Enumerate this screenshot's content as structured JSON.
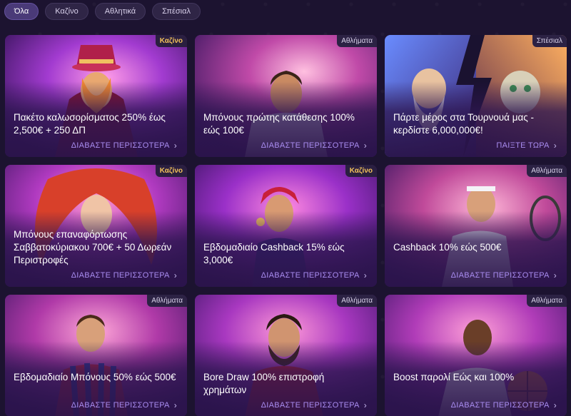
{
  "filters": [
    {
      "label": "Όλα",
      "active": true
    },
    {
      "label": "Καζίνο",
      "active": false
    },
    {
      "label": "Αθλητικά",
      "active": false
    },
    {
      "label": "Σπέσιαλ",
      "active": false
    }
  ],
  "cards": [
    {
      "badge": "Καζίνο",
      "title": "Πακέτο καλωσορίσματος 250% έως 2,500€ + 250 ΔΠ",
      "cta": "ΔΙΑΒΑΣΤΕ ΠΕΡΙΣΣΟΤΕΡΑ"
    },
    {
      "badge": "Αθλήματα",
      "title": "Μπόνους πρώτης κατάθεσης 100% εώς 100€",
      "cta": "ΔΙΑΒΑΣΤΕ ΠΕΡΙΣΣΟΤΕΡΑ"
    },
    {
      "badge": "Σπέσιαλ",
      "title": "Πάρτε μέρος στα Τουρνουά μας - κερδίστε 6,000,000€!",
      "cta": "ΠΑΙΞΤΕ ΤΩΡΑ"
    },
    {
      "badge": "Καζίνο",
      "title": "Μπόνους επαναφόρτωσης Σαββατοκύριακου 700€ + 50 Δωρεάν Περιστροφές",
      "cta": "ΔΙΑΒΑΣΤΕ ΠΕΡΙΣΣΟΤΕΡΑ"
    },
    {
      "badge": "Καζίνο",
      "title": "Εβδομαδιαίο Cashback 15% εώς 3,000€",
      "cta": "ΔΙΑΒΑΣΤΕ ΠΕΡΙΣΣΟΤΕΡΑ"
    },
    {
      "badge": "Αθλήματα",
      "title": "Cashback 10% εώς 500€",
      "cta": "ΔΙΑΒΑΣΤΕ ΠΕΡΙΣΣΟΤΕΡΑ"
    },
    {
      "badge": "Αθλήματα",
      "title": "Εβδομαδιαίο Μπόνους 50% εώς 500€",
      "cta": "ΔΙΑΒΑΣΤΕ ΠΕΡΙΣΣΟΤΕΡΑ"
    },
    {
      "badge": "Αθλήματα",
      "title": "Bore Draw 100% επιστροφή χρημάτων",
      "cta": "ΔΙΑΒΑΣΤΕ ΠΕΡΙΣΣΟΤΕΡΑ"
    },
    {
      "badge": "Αθλήματα",
      "title": "Boost παρολί Εώς και 100%",
      "cta": "ΔΙΑΒΑΣΤΕ ΠΕΡΙΣΣΟΤΕΡΑ"
    }
  ],
  "colors": {
    "background": "#1c1330",
    "casino_badge": "#f2c15a",
    "cta": "#a98cf0"
  },
  "icons": {
    "cta": "chevron-right-icon"
  }
}
